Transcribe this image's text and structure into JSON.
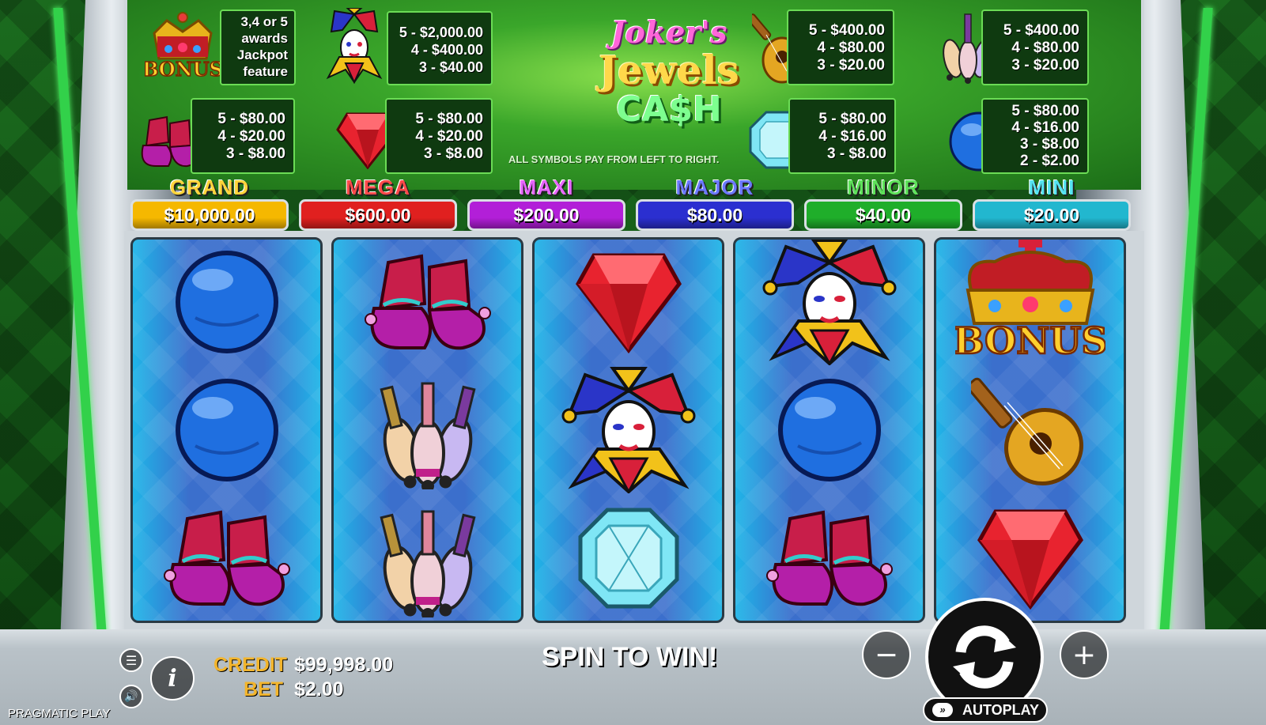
{
  "game": {
    "logo": {
      "line1": "Joker's",
      "line2": "Jewels",
      "line3": "CA$H"
    },
    "pay_note": "ALL SYMBOLS PAY FROM LEFT TO RIGHT.",
    "paytable": {
      "bonus": {
        "symbol": "bonus-crown-icon",
        "label": "BONUS",
        "lines": [
          "3,4 or 5",
          "awards",
          "Jackpot",
          "feature"
        ]
      },
      "joker": {
        "symbol": "joker-icon",
        "lines": [
          "5 - $2,000.00",
          "4 - $400.00",
          "3 - $40.00"
        ]
      },
      "lute": {
        "symbol": "lute-icon",
        "lines": [
          "5 - $400.00",
          "4 - $80.00",
          "3 - $20.00"
        ]
      },
      "pins": {
        "symbol": "juggling-pins-icon",
        "lines": [
          "5 - $400.00",
          "4 - $80.00",
          "3 - $20.00"
        ]
      },
      "shoes": {
        "symbol": "jester-shoes-icon",
        "lines": [
          "5 - $80.00",
          "4 - $20.00",
          "3 - $8.00"
        ]
      },
      "ruby": {
        "symbol": "ruby-icon",
        "lines": [
          "5 - $80.00",
          "4 - $20.00",
          "3 - $8.00"
        ]
      },
      "diamond": {
        "symbol": "diamond-icon",
        "lines": [
          "5 - $80.00",
          "4 - $16.00",
          "3 - $8.00"
        ]
      },
      "ball": {
        "symbol": "blue-ball-icon",
        "lines": [
          "5 - $80.00",
          "4 - $16.00",
          "3 - $8.00",
          "2 - $2.00"
        ]
      }
    },
    "jackpots": [
      {
        "name": "GRAND",
        "value": "$10,000.00",
        "color": "#f5b800",
        "name_color": "#ffd43a"
      },
      {
        "name": "MEGA",
        "value": "$600.00",
        "color": "#e0201f",
        "name_color": "#ff4a4a"
      },
      {
        "name": "MAXI",
        "value": "$200.00",
        "color": "#b21fd8",
        "name_color": "#e766ff"
      },
      {
        "name": "MAJOR",
        "value": "$80.00",
        "color": "#2b2fd0",
        "name_color": "#6b78ff"
      },
      {
        "name": "MINOR",
        "value": "$40.00",
        "color": "#1fae2a",
        "name_color": "#5ee25a"
      },
      {
        "name": "MINI",
        "value": "$20.00",
        "color": "#22b7cf",
        "name_color": "#55e4f2"
      }
    ],
    "reels": [
      [
        "blue-ball-icon",
        "blue-ball-icon",
        "jester-shoes-icon"
      ],
      [
        "jester-shoes-icon",
        "juggling-pins-icon",
        "juggling-pins-icon"
      ],
      [
        "ruby-icon",
        "joker-icon",
        "diamond-icon"
      ],
      [
        "joker-icon",
        "blue-ball-icon",
        "jester-shoes-icon"
      ],
      [
        "bonus-crown-icon",
        "lute-icon",
        "ruby-icon"
      ]
    ]
  },
  "controls": {
    "credit_label": "CREDIT",
    "credit_value": "$99,998.00",
    "bet_label": "BET",
    "bet_value": "$2.00",
    "message": "SPIN TO WIN!",
    "autoplay_label": "AUTOPLAY",
    "brand": "PRAGMATIC PLAY"
  }
}
